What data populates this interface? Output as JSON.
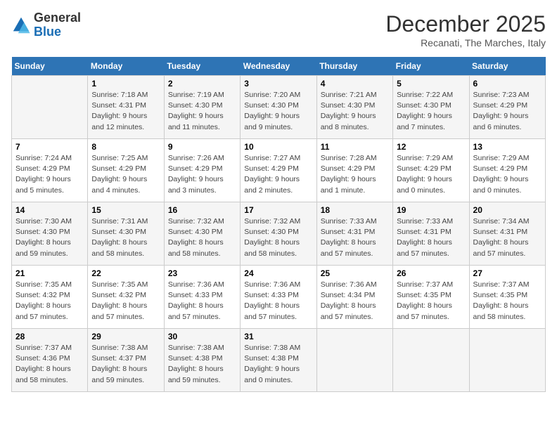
{
  "header": {
    "logo_line1": "General",
    "logo_line2": "Blue",
    "month": "December 2025",
    "subtitle": "Recanati, The Marches, Italy"
  },
  "days_of_week": [
    "Sunday",
    "Monday",
    "Tuesday",
    "Wednesday",
    "Thursday",
    "Friday",
    "Saturday"
  ],
  "weeks": [
    [
      {
        "num": "",
        "info": ""
      },
      {
        "num": "1",
        "info": "Sunrise: 7:18 AM\nSunset: 4:31 PM\nDaylight: 9 hours\nand 12 minutes."
      },
      {
        "num": "2",
        "info": "Sunrise: 7:19 AM\nSunset: 4:30 PM\nDaylight: 9 hours\nand 11 minutes."
      },
      {
        "num": "3",
        "info": "Sunrise: 7:20 AM\nSunset: 4:30 PM\nDaylight: 9 hours\nand 9 minutes."
      },
      {
        "num": "4",
        "info": "Sunrise: 7:21 AM\nSunset: 4:30 PM\nDaylight: 9 hours\nand 8 minutes."
      },
      {
        "num": "5",
        "info": "Sunrise: 7:22 AM\nSunset: 4:30 PM\nDaylight: 9 hours\nand 7 minutes."
      },
      {
        "num": "6",
        "info": "Sunrise: 7:23 AM\nSunset: 4:29 PM\nDaylight: 9 hours\nand 6 minutes."
      }
    ],
    [
      {
        "num": "7",
        "info": "Sunrise: 7:24 AM\nSunset: 4:29 PM\nDaylight: 9 hours\nand 5 minutes."
      },
      {
        "num": "8",
        "info": "Sunrise: 7:25 AM\nSunset: 4:29 PM\nDaylight: 9 hours\nand 4 minutes."
      },
      {
        "num": "9",
        "info": "Sunrise: 7:26 AM\nSunset: 4:29 PM\nDaylight: 9 hours\nand 3 minutes."
      },
      {
        "num": "10",
        "info": "Sunrise: 7:27 AM\nSunset: 4:29 PM\nDaylight: 9 hours\nand 2 minutes."
      },
      {
        "num": "11",
        "info": "Sunrise: 7:28 AM\nSunset: 4:29 PM\nDaylight: 9 hours\nand 1 minute."
      },
      {
        "num": "12",
        "info": "Sunrise: 7:29 AM\nSunset: 4:29 PM\nDaylight: 9 hours\nand 0 minutes."
      },
      {
        "num": "13",
        "info": "Sunrise: 7:29 AM\nSunset: 4:29 PM\nDaylight: 9 hours\nand 0 minutes."
      }
    ],
    [
      {
        "num": "14",
        "info": "Sunrise: 7:30 AM\nSunset: 4:30 PM\nDaylight: 8 hours\nand 59 minutes."
      },
      {
        "num": "15",
        "info": "Sunrise: 7:31 AM\nSunset: 4:30 PM\nDaylight: 8 hours\nand 58 minutes."
      },
      {
        "num": "16",
        "info": "Sunrise: 7:32 AM\nSunset: 4:30 PM\nDaylight: 8 hours\nand 58 minutes."
      },
      {
        "num": "17",
        "info": "Sunrise: 7:32 AM\nSunset: 4:30 PM\nDaylight: 8 hours\nand 58 minutes."
      },
      {
        "num": "18",
        "info": "Sunrise: 7:33 AM\nSunset: 4:31 PM\nDaylight: 8 hours\nand 57 minutes."
      },
      {
        "num": "19",
        "info": "Sunrise: 7:33 AM\nSunset: 4:31 PM\nDaylight: 8 hours\nand 57 minutes."
      },
      {
        "num": "20",
        "info": "Sunrise: 7:34 AM\nSunset: 4:31 PM\nDaylight: 8 hours\nand 57 minutes."
      }
    ],
    [
      {
        "num": "21",
        "info": "Sunrise: 7:35 AM\nSunset: 4:32 PM\nDaylight: 8 hours\nand 57 minutes."
      },
      {
        "num": "22",
        "info": "Sunrise: 7:35 AM\nSunset: 4:32 PM\nDaylight: 8 hours\nand 57 minutes."
      },
      {
        "num": "23",
        "info": "Sunrise: 7:36 AM\nSunset: 4:33 PM\nDaylight: 8 hours\nand 57 minutes."
      },
      {
        "num": "24",
        "info": "Sunrise: 7:36 AM\nSunset: 4:33 PM\nDaylight: 8 hours\nand 57 minutes."
      },
      {
        "num": "25",
        "info": "Sunrise: 7:36 AM\nSunset: 4:34 PM\nDaylight: 8 hours\nand 57 minutes."
      },
      {
        "num": "26",
        "info": "Sunrise: 7:37 AM\nSunset: 4:35 PM\nDaylight: 8 hours\nand 57 minutes."
      },
      {
        "num": "27",
        "info": "Sunrise: 7:37 AM\nSunset: 4:35 PM\nDaylight: 8 hours\nand 58 minutes."
      }
    ],
    [
      {
        "num": "28",
        "info": "Sunrise: 7:37 AM\nSunset: 4:36 PM\nDaylight: 8 hours\nand 58 minutes."
      },
      {
        "num": "29",
        "info": "Sunrise: 7:38 AM\nSunset: 4:37 PM\nDaylight: 8 hours\nand 59 minutes."
      },
      {
        "num": "30",
        "info": "Sunrise: 7:38 AM\nSunset: 4:38 PM\nDaylight: 8 hours\nand 59 minutes."
      },
      {
        "num": "31",
        "info": "Sunrise: 7:38 AM\nSunset: 4:38 PM\nDaylight: 9 hours\nand 0 minutes."
      },
      {
        "num": "",
        "info": ""
      },
      {
        "num": "",
        "info": ""
      },
      {
        "num": "",
        "info": ""
      }
    ]
  ]
}
